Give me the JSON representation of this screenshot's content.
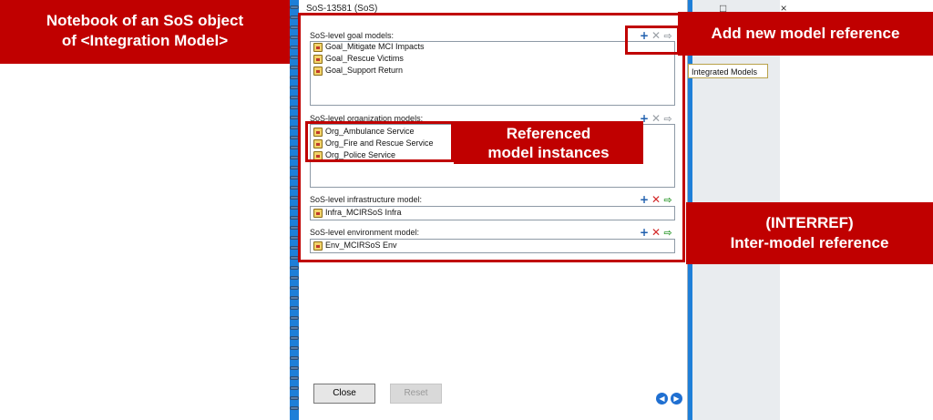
{
  "window": {
    "title": "SoS-13581 (SoS)",
    "controls": "□ ×"
  },
  "sections": [
    {
      "label": "SoS-level goal models:",
      "items": [
        "Goal_Mitigate MCI Impacts",
        "Goal_Rescue Victims",
        "Goal_Support Return"
      ]
    },
    {
      "label": "SoS-level organization models:",
      "items": [
        "Org_Ambulance Service",
        "Org_Fire and Rescue Service",
        "Org_Police Service"
      ]
    },
    {
      "label": "SoS-level infrastructure model:",
      "items": [
        "Infra_MCIRSoS Infra"
      ]
    },
    {
      "label": "SoS-level environment model:",
      "items": [
        "Env_MCIRSoS Env"
      ]
    }
  ],
  "icons": {
    "add": "+",
    "remove": "✕",
    "goto": "⇨"
  },
  "side_tab": {
    "label": "Integrated Models"
  },
  "buttons": {
    "close": "Close",
    "reset": "Reset",
    "prev": "◀",
    "next": "▶"
  },
  "annotations": {
    "notebook": {
      "line1": "Notebook of an SoS object",
      "line2": "of <Integration Model>"
    },
    "add_new": "Add new model reference",
    "referenced": {
      "line1": "Referenced",
      "line2": "model instances"
    },
    "interref": {
      "line1": "(INTERREF)",
      "line2": "Inter-model reference"
    }
  },
  "colors": {
    "annotation_red": "#c00000",
    "app_blue": "#1e7fd8",
    "add_icon": "#1f5fae",
    "remove_icon_active": "#d22828",
    "goto_icon_active": "#2f9a2f"
  }
}
